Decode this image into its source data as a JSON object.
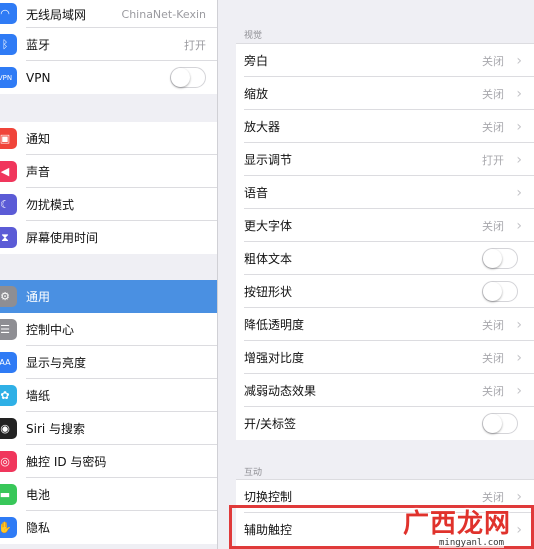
{
  "sidebar": {
    "group1": [
      {
        "label": "无线局域网",
        "value": "ChinaNet-Kexin",
        "icon": "wifi-icon",
        "color": "#2f7bf5"
      },
      {
        "label": "蓝牙",
        "value": "打开",
        "icon": "bluetooth-icon",
        "color": "#2f7bf5"
      },
      {
        "label": "VPN",
        "toggle": false,
        "icon": "vpn-icon",
        "color": "#2f7bf5"
      }
    ],
    "group2": [
      {
        "label": "通知",
        "icon": "notifications-icon",
        "color": "#f0443a"
      },
      {
        "label": "声音",
        "icon": "sound-icon",
        "color": "#f0365c"
      },
      {
        "label": "勿扰模式",
        "icon": "moon-icon",
        "color": "#5b5bd6"
      },
      {
        "label": "屏幕使用时间",
        "icon": "hourglass-icon",
        "color": "#5b5bd6"
      }
    ],
    "group3": [
      {
        "label": "通用",
        "icon": "gear-icon",
        "color": "#8e8e93",
        "selected": true
      },
      {
        "label": "控制中心",
        "icon": "control-center-icon",
        "color": "#8e8e93"
      },
      {
        "label": "显示与亮度",
        "icon": "display-icon",
        "color": "#2f7bf5"
      },
      {
        "label": "墙纸",
        "icon": "wallpaper-icon",
        "color": "#2fb0e6"
      },
      {
        "label": "Siri 与搜索",
        "icon": "siri-icon",
        "color": "#222"
      },
      {
        "label": "触控 ID 与密码",
        "icon": "fingerprint-icon",
        "color": "#f0365c"
      },
      {
        "label": "电池",
        "icon": "battery-icon",
        "color": "#38c759"
      },
      {
        "label": "隐私",
        "icon": "hand-icon",
        "color": "#2f7bf5"
      }
    ],
    "accent": "#4a90e2"
  },
  "main": {
    "vision": {
      "header": "视觉",
      "rows": [
        {
          "label": "旁白",
          "value": "关闭"
        },
        {
          "label": "缩放",
          "value": "关闭"
        },
        {
          "label": "放大器",
          "value": "关闭"
        },
        {
          "label": "显示调节",
          "value": "打开"
        },
        {
          "label": "语音",
          "value": ""
        },
        {
          "label": "更大字体",
          "value": "关闭"
        },
        {
          "label": "粗体文本",
          "toggle": false
        },
        {
          "label": "按钮形状",
          "toggle": false
        },
        {
          "label": "降低透明度",
          "value": "关闭"
        },
        {
          "label": "增强对比度",
          "value": "关闭"
        },
        {
          "label": "减弱动态效果",
          "value": "关闭"
        },
        {
          "label": "开/关标签",
          "toggle": false
        }
      ]
    },
    "interaction": {
      "header": "互动",
      "rows": [
        {
          "label": "切换控制",
          "value": "关闭"
        },
        {
          "label": "辅助触控",
          "value": ""
        }
      ]
    },
    "highlight_color": "#e03a3a"
  },
  "watermark": {
    "text": "广西龙网",
    "url": "mingyanl.com"
  }
}
